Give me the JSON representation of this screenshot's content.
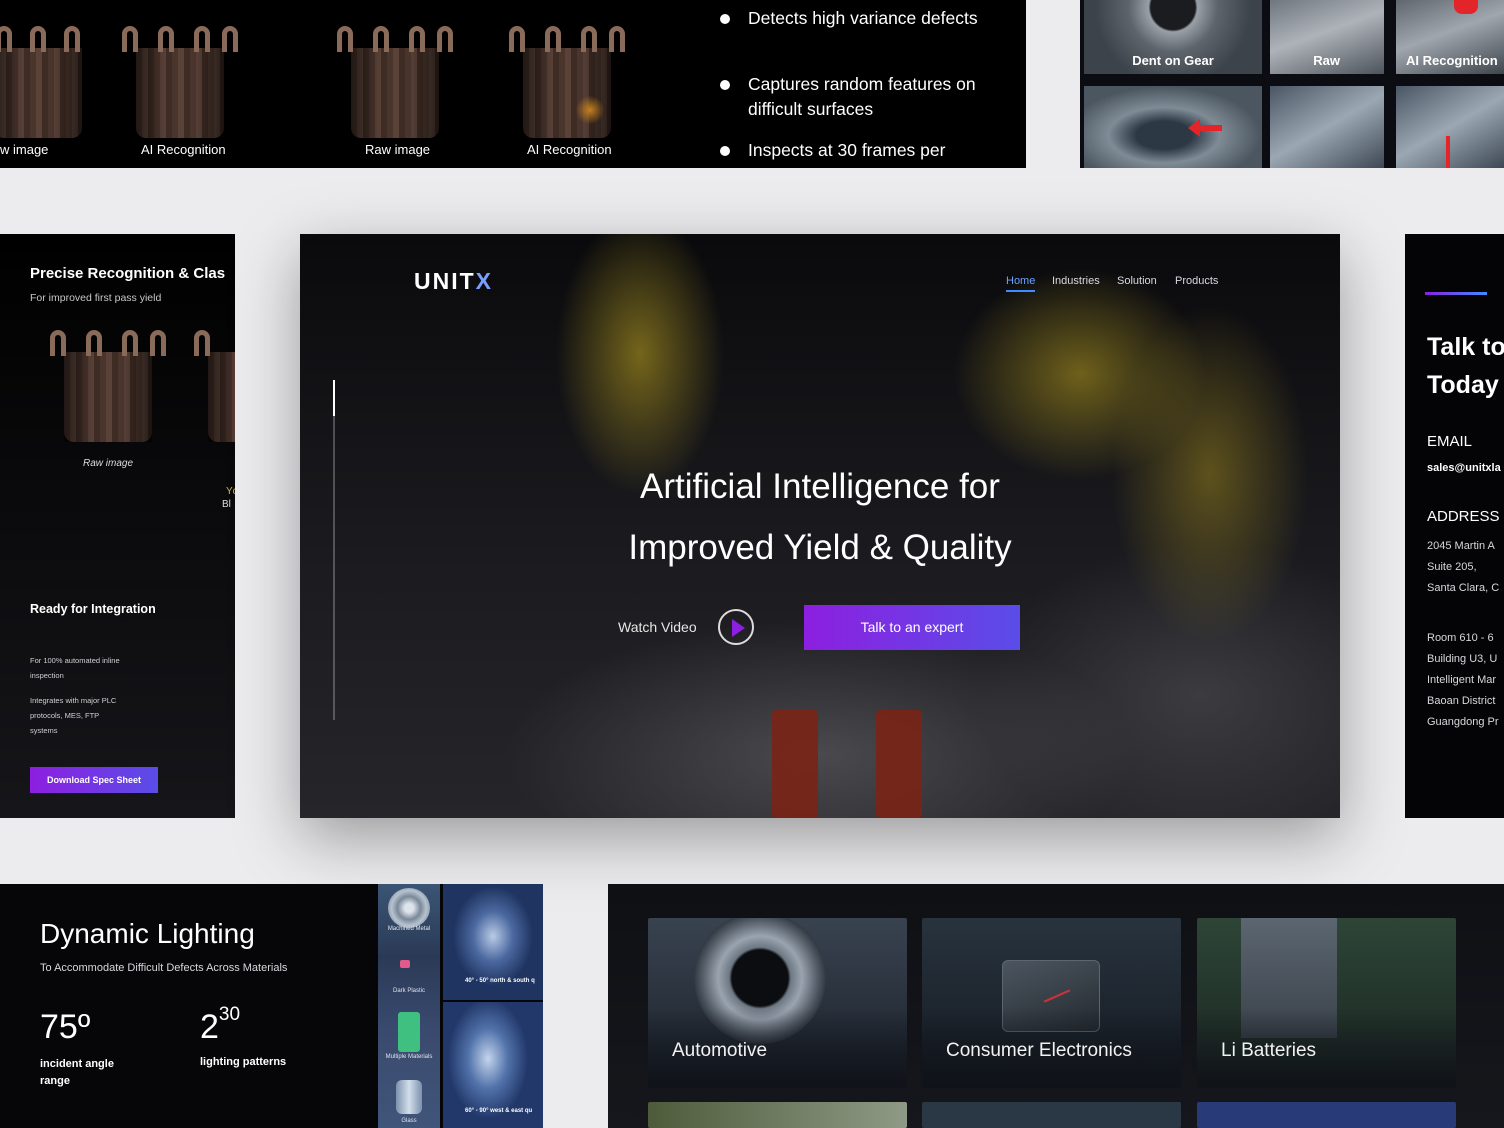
{
  "top_left": {
    "captions": [
      "w image",
      "AI Recognition",
      "Raw image",
      "AI Recognition"
    ],
    "bullets": [
      "Detects high variance defects",
      "Captures random features on difficult surfaces",
      "Inspects at 30 frames per"
    ]
  },
  "top_right": {
    "tiles": [
      "Dent on Gear",
      "Raw",
      "AI Recognition"
    ]
  },
  "left_panel": {
    "title": "Precise Recognition & Clas",
    "subtitle": "For improved first pass yield",
    "raw_caption": "Raw image",
    "cut_text_1": "Yc",
    "cut_text_2": "Bl",
    "integration_title": "Ready for Integration",
    "integration_line1": "For 100% automated inline",
    "integration_line2": "inspection",
    "plc_line1": "Integrates with major PLC",
    "plc_line2": "protocols, MES, FTP",
    "plc_line3": "systems",
    "download_button": "Download Spec Sheet"
  },
  "hero": {
    "logo_text": "UNIT",
    "logo_mark": "X",
    "nav": [
      "Home",
      "Industries",
      "Solution",
      "Products"
    ],
    "headline_line1": "Artificial Intelligence for",
    "headline_line2": "Improved Yield & Quality",
    "watch_video": "Watch Video",
    "cta": "Talk to an expert",
    "colors": {
      "accent": "#8d1fe0",
      "accent2": "#5a4de8",
      "nav_active": "#3f8cff"
    }
  },
  "right_panel": {
    "title_line1": "Talk to",
    "title_line2": "Today",
    "email_label": "EMAIL",
    "email_value": "sales@unitxla",
    "address_label": "ADDRESS",
    "address_lines": [
      "2045 Martin A",
      "Suite 205,",
      "Santa Clara, C"
    ],
    "address2_lines": [
      "Room 610 - 6",
      "Building U3, U",
      "Intelligent Mar",
      "Baoan District",
      "Guangdong Pr"
    ]
  },
  "lighting": {
    "title": "Dynamic Lighting",
    "subtitle": "To Accommodate Difficult Defects Across Materials",
    "stat1_value": "75º",
    "stat1_label_line1": "incident angle",
    "stat1_label_line2": "range",
    "stat2_base": "2",
    "stat2_exp": "30",
    "stat2_label": "lighting patterns",
    "materials": [
      "Machined Metal",
      "Dark Plastic",
      "Multiple Materials",
      "Glass"
    ],
    "angles": [
      "40° - 50° north & south q",
      "60° - 90° west & east qu"
    ]
  },
  "industries": {
    "cards": [
      "Automotive",
      "Consumer Electronics",
      "Li Batteries"
    ]
  }
}
